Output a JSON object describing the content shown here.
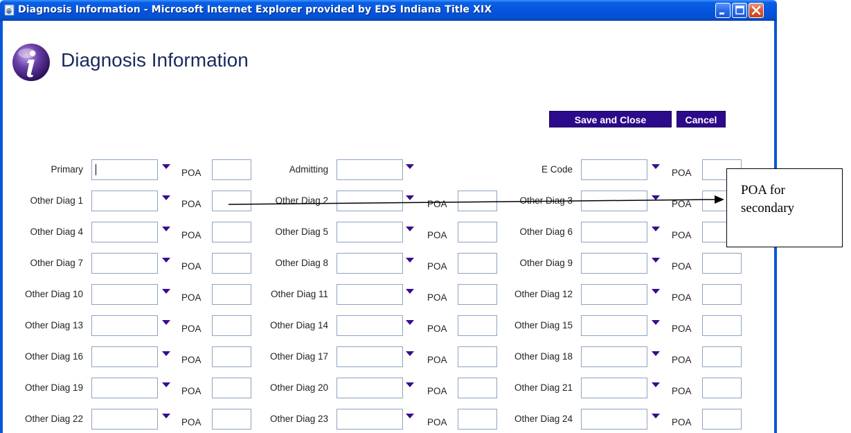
{
  "window": {
    "title": "Diagnosis Information - Microsoft Internet Explorer provided by EDS Indiana Title XIX",
    "icon": "ie-page-icon",
    "controls": [
      "minimize-icon",
      "maximize-icon",
      "close-icon"
    ]
  },
  "page": {
    "title": "Diagnosis Information",
    "logo": "info-icon"
  },
  "actions": {
    "save_label": "Save and Close",
    "cancel_label": "Cancel"
  },
  "form": {
    "poa_label": "POA",
    "rows": [
      [
        {
          "label": "Primary",
          "value": "",
          "poa": true
        },
        {
          "label": "Admitting",
          "value": "",
          "poa": false
        },
        {
          "label": "E Code",
          "value": "",
          "poa": true
        }
      ],
      [
        {
          "label": "Other Diag 1",
          "value": "",
          "poa": true
        },
        {
          "label": "Other Diag 2",
          "value": "",
          "poa": true
        },
        {
          "label": "Other Diag 3",
          "value": "",
          "poa": true
        }
      ],
      [
        {
          "label": "Other Diag 4",
          "value": "",
          "poa": true
        },
        {
          "label": "Other Diag 5",
          "value": "",
          "poa": true
        },
        {
          "label": "Other Diag 6",
          "value": "",
          "poa": true
        }
      ],
      [
        {
          "label": "Other Diag 7",
          "value": "",
          "poa": true
        },
        {
          "label": "Other Diag 8",
          "value": "",
          "poa": true
        },
        {
          "label": "Other Diag 9",
          "value": "",
          "poa": true
        }
      ],
      [
        {
          "label": "Other Diag 10",
          "value": "",
          "poa": true
        },
        {
          "label": "Other Diag 11",
          "value": "",
          "poa": true
        },
        {
          "label": "Other Diag 12",
          "value": "",
          "poa": true
        }
      ],
      [
        {
          "label": "Other Diag 13",
          "value": "",
          "poa": true
        },
        {
          "label": "Other Diag 14",
          "value": "",
          "poa": true
        },
        {
          "label": "Other Diag 15",
          "value": "",
          "poa": true
        }
      ],
      [
        {
          "label": "Other Diag 16",
          "value": "",
          "poa": true
        },
        {
          "label": "Other Diag 17",
          "value": "",
          "poa": true
        },
        {
          "label": "Other Diag 18",
          "value": "",
          "poa": true
        }
      ],
      [
        {
          "label": "Other Diag 19",
          "value": "",
          "poa": true
        },
        {
          "label": "Other Diag 20",
          "value": "",
          "poa": true
        },
        {
          "label": "Other Diag 21",
          "value": "",
          "poa": true
        }
      ],
      [
        {
          "label": "Other Diag 22",
          "value": "",
          "poa": true
        },
        {
          "label": "Other Diag 23",
          "value": "",
          "poa": true
        },
        {
          "label": "Other Diag 24",
          "value": "",
          "poa": true
        }
      ]
    ]
  },
  "annotation": {
    "text": "POA for\nsecondary"
  },
  "colors": {
    "titlebar": "#0554de",
    "button_bg": "#2d0a8a",
    "dropdown_arrow": "#3a0a8f",
    "heading_text": "#1a2a5e"
  }
}
